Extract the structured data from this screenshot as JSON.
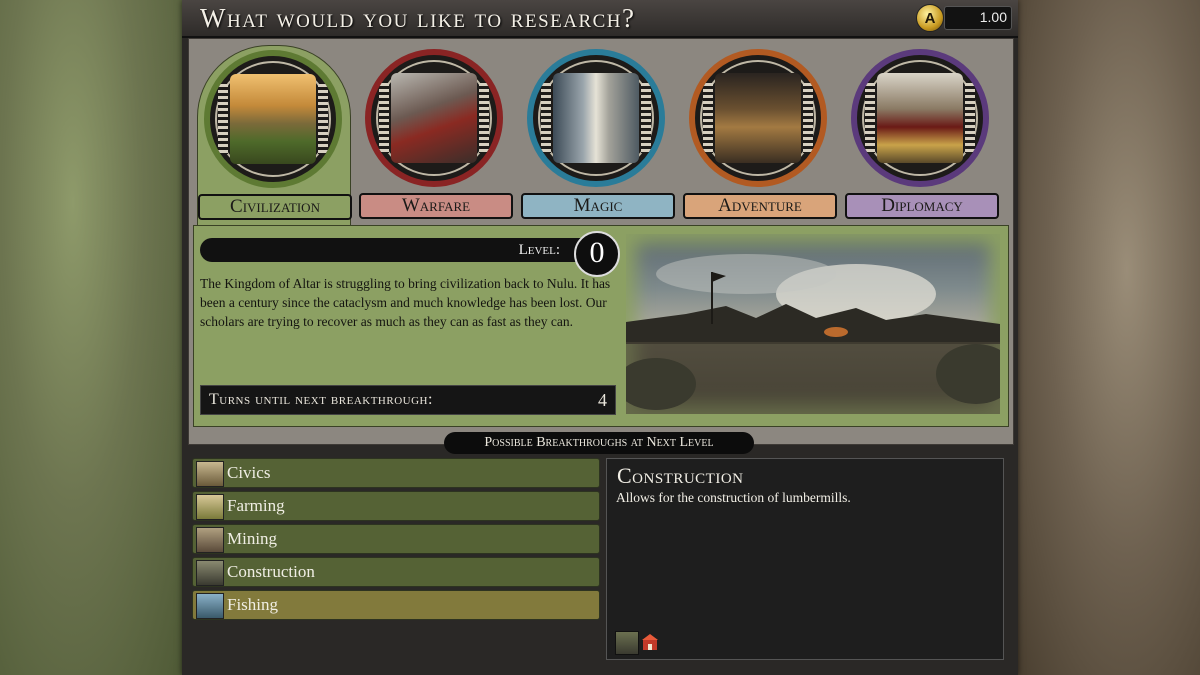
{
  "header": {
    "title": "What would you like to research?",
    "gold": "1.00",
    "gold_icon": "gold-coin-icon"
  },
  "tabs": [
    {
      "label": "Civilization",
      "color": "#8ca063",
      "ring": "#5e7a33",
      "active": true
    },
    {
      "label": "Warfare",
      "color": "#c98c84",
      "ring": "#8a2424",
      "active": false
    },
    {
      "label": "Magic",
      "color": "#8fb4c3",
      "ring": "#2a7c99",
      "active": false
    },
    {
      "label": "Adventure",
      "color": "#d9a47a",
      "ring": "#b25a22",
      "active": false
    },
    {
      "label": "Diplomacy",
      "color": "#a890b8",
      "ring": "#5b3a7c",
      "active": false
    }
  ],
  "research": {
    "level_label": "Level:",
    "level_value": "0",
    "description": "The Kingdom of Altar is struggling to bring civilization back to Nulu. It has been a century since the cataclysm and much knowledge has been lost. Our scholars are trying to recover as much as they can as fast as they can.",
    "turns_label": "Turns until next breakthrough:",
    "turns_value": "4"
  },
  "breakthroughs": {
    "banner": "Possible Breakthroughs at Next Level",
    "items": [
      {
        "label": "Civics",
        "selected": false
      },
      {
        "label": "Farming",
        "selected": false
      },
      {
        "label": "Mining",
        "selected": false
      },
      {
        "label": "Construction",
        "selected": false
      },
      {
        "label": "Fishing",
        "selected": true
      }
    ]
  },
  "details": {
    "title": "Construction",
    "text": "Allows for the construction of lumbermills."
  }
}
